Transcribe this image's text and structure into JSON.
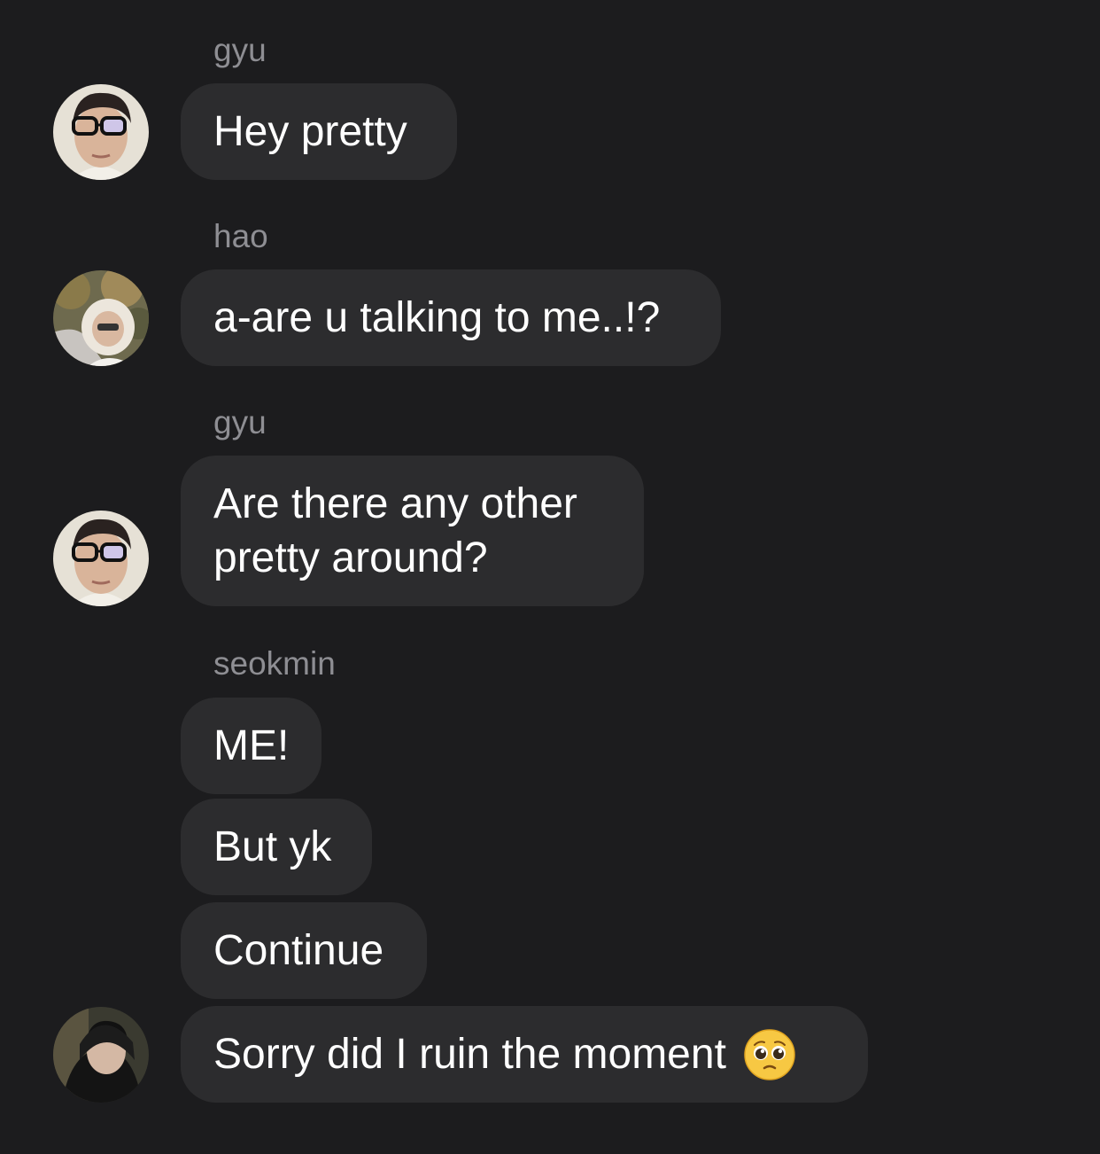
{
  "messages": [
    {
      "sender": "gyu",
      "text": "Hey pretty"
    },
    {
      "sender": "hao",
      "text": "a-are u talking to me..!?"
    },
    {
      "sender": "gyu",
      "text": "Are there any other pretty around?",
      "lines": [
        "Are there any other",
        "pretty around?"
      ]
    },
    {
      "sender": "seokmin",
      "text": "ME!"
    },
    {
      "text": "But yk"
    },
    {
      "text": "Continue"
    },
    {
      "text": "Sorry did I ruin the moment",
      "emoji": "pleading-face-icon"
    }
  ],
  "colors": {
    "background": "#1c1c1e",
    "bubble": "#2c2c2e",
    "sender_name": "#8e8e93",
    "text": "#ffffff"
  }
}
